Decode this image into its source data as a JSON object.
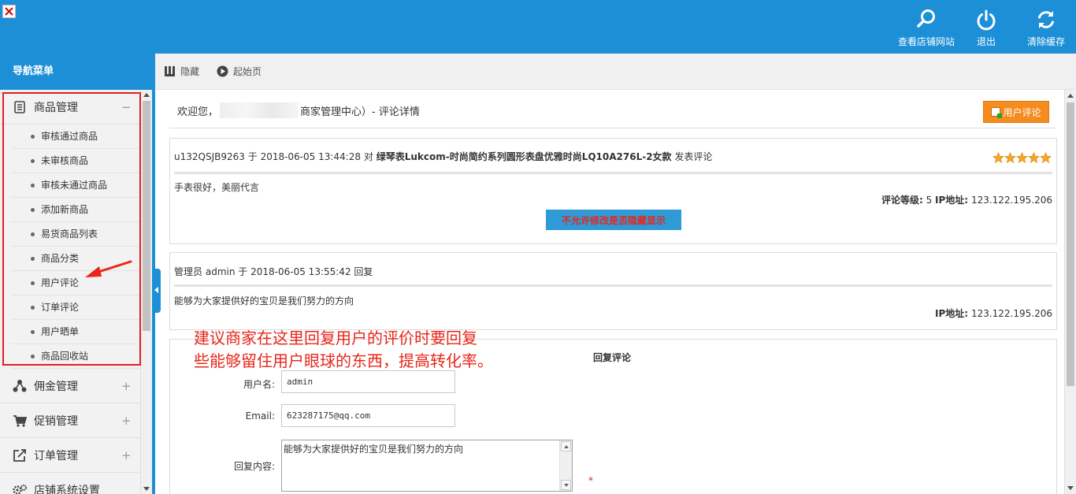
{
  "top": {
    "actions": [
      {
        "label": "查看店铺网站",
        "icon": "search-icon"
      },
      {
        "label": "退出",
        "icon": "power-icon"
      },
      {
        "label": "清除缓存",
        "icon": "refresh-icon"
      }
    ]
  },
  "sidebar": {
    "title": "导航菜单",
    "groups": [
      {
        "label": "商品管理",
        "icon": "goods-icon",
        "sign": "−",
        "items": [
          "审核通过商品",
          "未审核商品",
          "审核未通过商品",
          "添加新商品",
          "易货商品列表",
          "商品分类",
          "用户评论",
          "订单评论",
          "用户晒单",
          "商品回收站"
        ]
      },
      {
        "label": "佣金管理",
        "icon": "share-icon",
        "sign": "+"
      },
      {
        "label": "促销管理",
        "icon": "cart-icon",
        "sign": "+"
      },
      {
        "label": "订单管理",
        "icon": "export-icon",
        "sign": "+"
      },
      {
        "label": "店铺系统设置",
        "icon": "settings-icon",
        "sign": ""
      }
    ]
  },
  "toolbar": {
    "hide_label": "隐藏",
    "home_label": "起始页"
  },
  "main": {
    "welcome_prefix": "欢迎您，",
    "welcome_suffix": "商家管理中心）- 评论详情",
    "user_review_button": "用户评论",
    "comment": {
      "user": "u132QSJB9263",
      "at": "于",
      "time": "2018-06-05 13:44:28",
      "on": "对",
      "product": "绿琴表Lukcom-时尚简约系列圆形表盘优雅时尚LQ10A276L-2女款",
      "action": "发表评论",
      "rating": 5,
      "text": "手表很好，美丽代言",
      "rating_label": "评论等级:",
      "rating_value": "5",
      "ip_label": "IP地址:",
      "ip": "123.122.195.206",
      "toggle_button": "不允许修改是否隐藏显示"
    },
    "reply": {
      "role": "管理员",
      "user": "admin",
      "at": "于",
      "time": "2018-06-05 13:55:42",
      "action": "回复",
      "text": "能够为大家提供好的宝贝是我们努力的方向",
      "ip_label": "IP地址:",
      "ip": "123.122.195.206"
    },
    "annotation_line1": "建议商家在这里回复用户的评价时要回复",
    "annotation_line2": "些能够留住用户眼球的东西，提高转化率。",
    "form": {
      "title": "回复评论",
      "username_label": "用户名:",
      "username_value": "admin",
      "email_label": "Email:",
      "email_value": "623287175@qq.com",
      "content_label": "回复内容:",
      "content_value": "能够为大家提供好的宝贝是我们努力的方向",
      "required_mark": "*"
    }
  }
}
